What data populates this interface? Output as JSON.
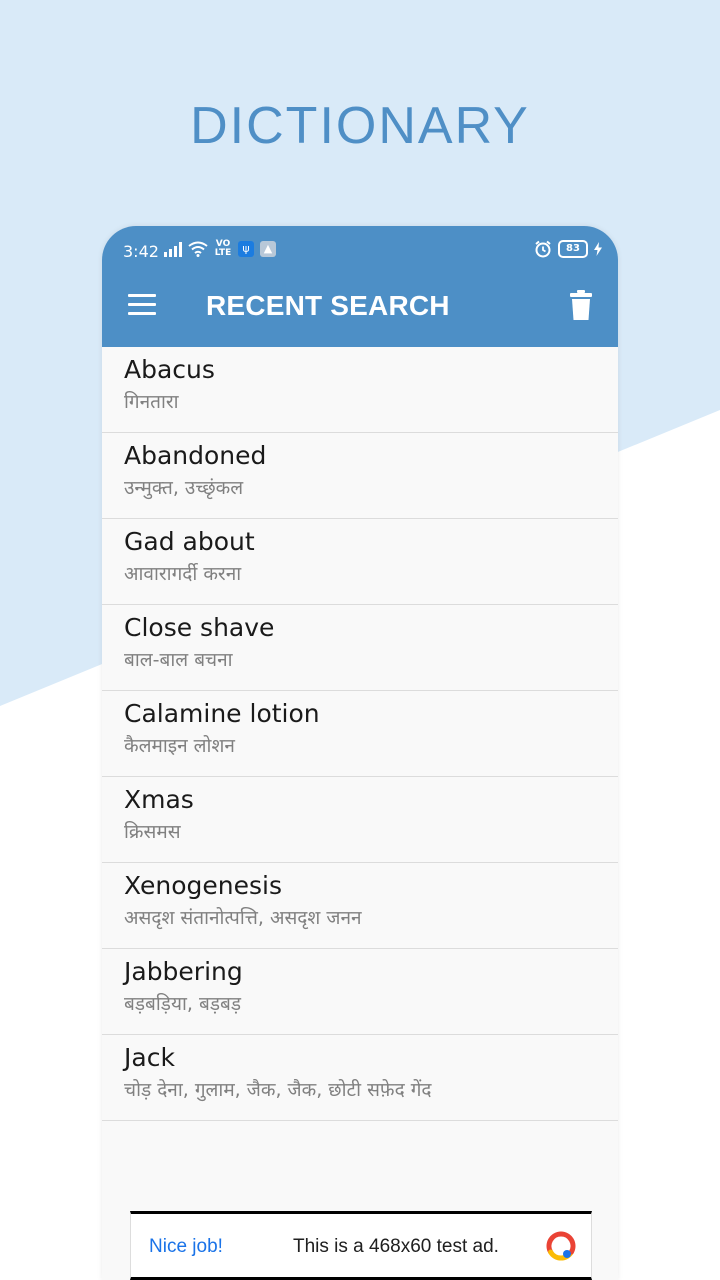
{
  "hero": {
    "title": "DICTIONARY"
  },
  "colors": {
    "accent": "#4d8fc6",
    "hero_bg": "#d9eaf8",
    "hero_title": "#4f8fc6",
    "list_bg": "#f9f9f9",
    "meaning_text": "#808080"
  },
  "status_bar": {
    "time": "3:42",
    "volte": "VO LTE",
    "battery": "83"
  },
  "app_bar": {
    "title": "RECENT SEARCH",
    "menu_icon": "hamburger-menu-icon",
    "trash_icon": "trash-icon"
  },
  "recent_searches": [
    {
      "word": "Abacus",
      "meaning": "गिनतारा"
    },
    {
      "word": "Abandoned",
      "meaning": "उन्मुक्त, उच्छृंकल"
    },
    {
      "word": "Gad about",
      "meaning": "आवारागर्दी करना"
    },
    {
      "word": "Close shave",
      "meaning": "बाल-बाल बचना"
    },
    {
      "word": "Calamine lotion",
      "meaning": "कैलमाइन लोशन"
    },
    {
      "word": "Xmas",
      "meaning": "क्रिसमस"
    },
    {
      "word": "Xenogenesis",
      "meaning": "असदृश संतानोत्पत्ति, असदृश जनन"
    },
    {
      "word": "Jabbering",
      "meaning": "बड़बड़िया, बड़बड़"
    },
    {
      "word": "Jack",
      "meaning": "चोड़ देना, गुलाम, जैक, जैक, छोटी सफ़ेद गेंद"
    }
  ],
  "ad": {
    "label": "Nice job!",
    "text": "This is a 468x60 test ad."
  }
}
